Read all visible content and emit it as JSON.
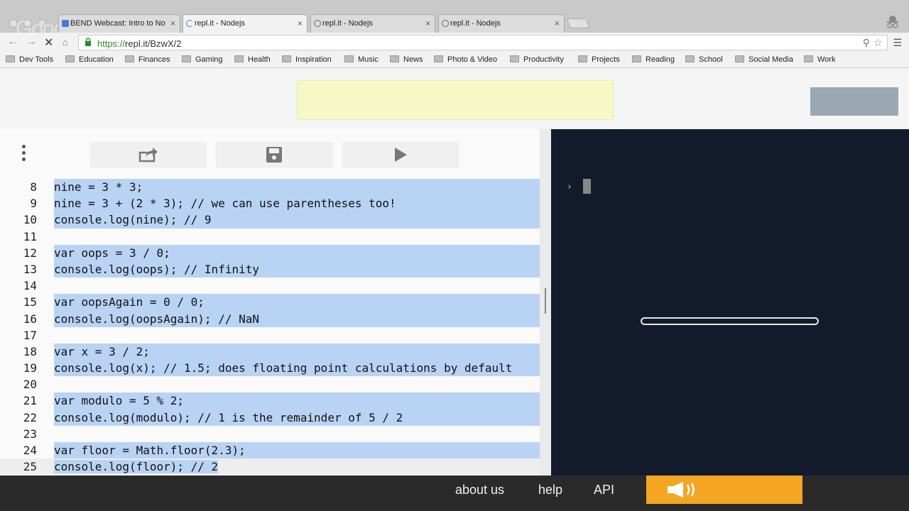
{
  "browser": {
    "tabs": [
      {
        "label": "BEND Webcast: Intro to No",
        "active": false
      },
      {
        "label": "repl.it - Nodejs",
        "active": true
      },
      {
        "label": "repl.it - Nodejs",
        "active": false
      },
      {
        "label": "repl.it - Nodejs",
        "active": false
      }
    ],
    "close_glyph": "×",
    "url_scheme": "https://",
    "url_rest": "repl.it/BzwX/2",
    "logo_text": "Google",
    "bookmarks": [
      "Dev Tools",
      "Education",
      "Finances",
      "Gaming",
      "Health",
      "Inspiration",
      "Music",
      "News",
      "Photo & Video",
      "Productivity",
      "Projects",
      "Reading",
      "School",
      "Social Media",
      "Work"
    ]
  },
  "editor": {
    "lines": [
      {
        "n": "8",
        "code": "nine = 3 * 3;"
      },
      {
        "n": "9",
        "code": "nine = 3 + (2 * 3); // we can use parentheses too!"
      },
      {
        "n": "10",
        "code": "console.log(nine); // 9"
      },
      {
        "n": "11",
        "code": ""
      },
      {
        "n": "12",
        "code": "var oops = 3 / 0;"
      },
      {
        "n": "13",
        "code": "console.log(oops); // Infinity"
      },
      {
        "n": "14",
        "code": ""
      },
      {
        "n": "15",
        "code": "var oopsAgain = 0 / 0;"
      },
      {
        "n": "16",
        "code": "console.log(oopsAgain); // NaN"
      },
      {
        "n": "17",
        "code": ""
      },
      {
        "n": "18",
        "code": "var x = 3 / 2;"
      },
      {
        "n": "19",
        "code": "console.log(x); // 1.5; does floating point calculations by default"
      },
      {
        "n": "20",
        "code": ""
      },
      {
        "n": "21",
        "code": "var modulo = 5 % 2;"
      },
      {
        "n": "22",
        "code": "console.log(modulo); // 1 is the remainder of 5 / 2"
      },
      {
        "n": "23",
        "code": ""
      },
      {
        "n": "24",
        "code": "var floor = Math.floor(2.3);"
      },
      {
        "n": "25",
        "code": "console.log(floor); // 2"
      }
    ]
  },
  "console": {
    "prompt": "›"
  },
  "footer": {
    "about": "about us",
    "help": "help",
    "api": "API"
  },
  "colors": {
    "selection": "#b9d3f4",
    "console_bg": "#131a2b",
    "feedback": "#f4a524"
  }
}
